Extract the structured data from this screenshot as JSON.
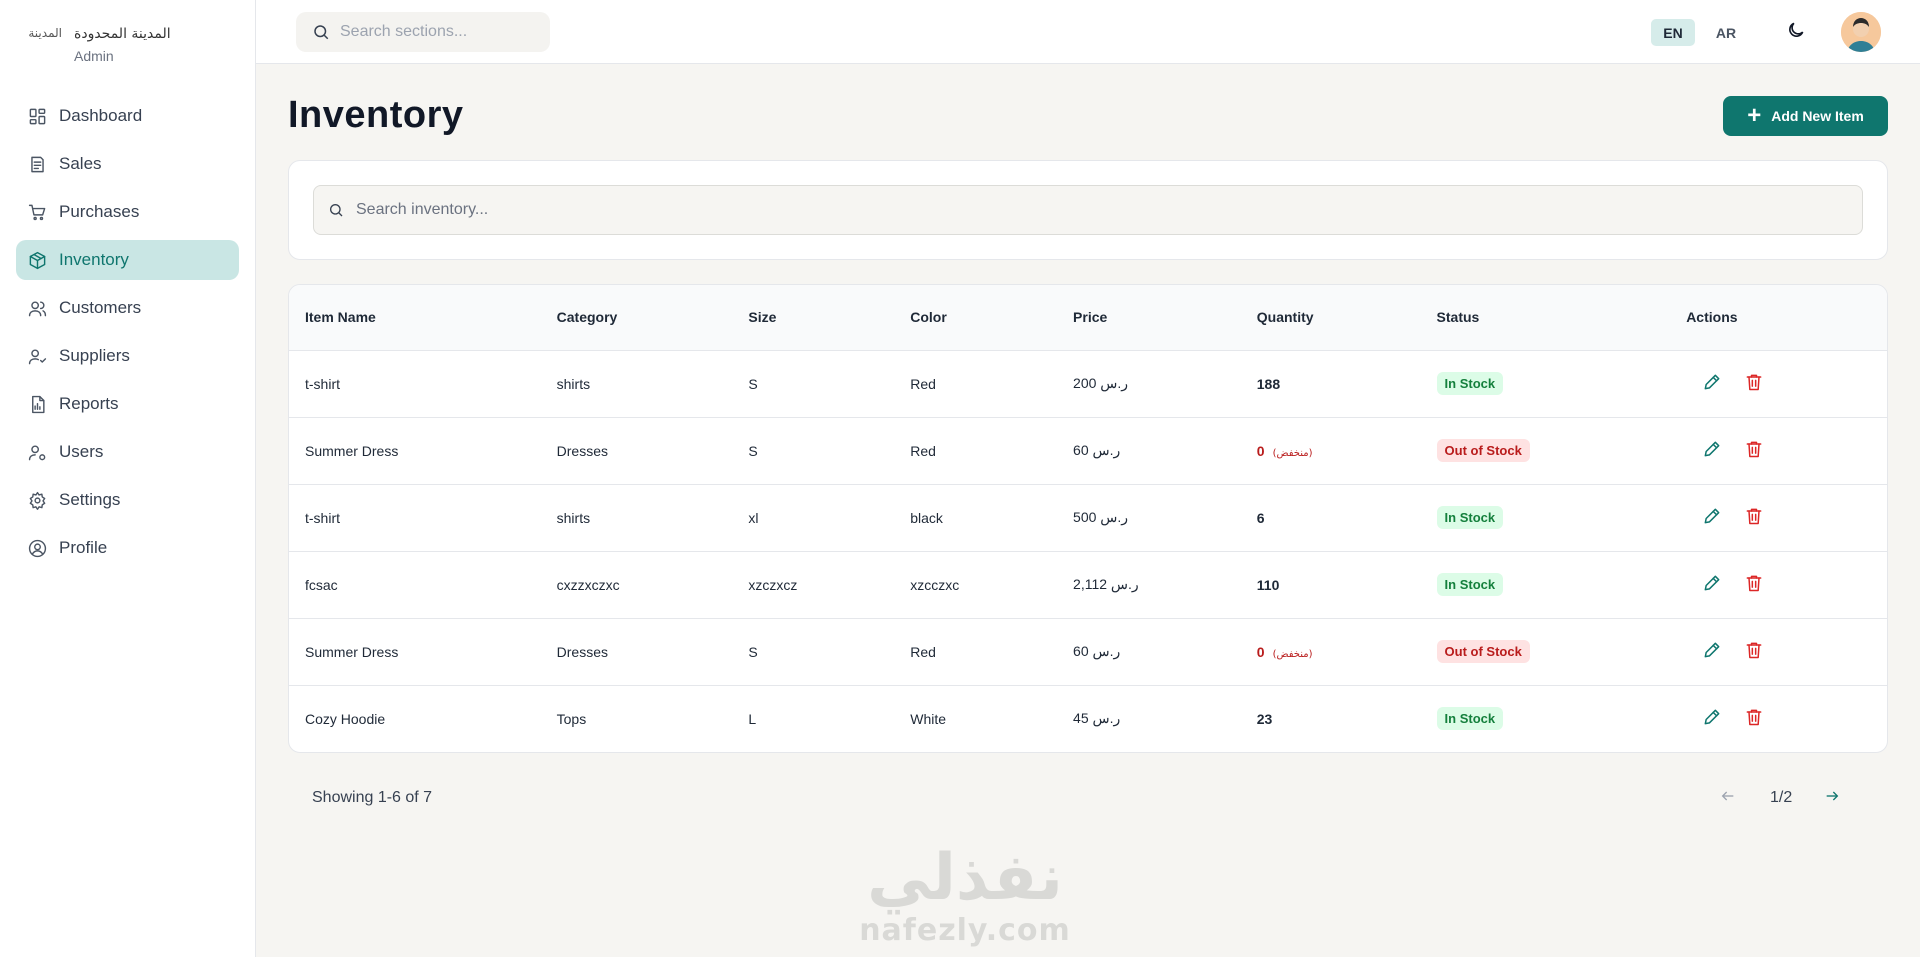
{
  "brand": {
    "logo_alt": "المدينة",
    "name": "المدينة المحدودة",
    "role": "Admin"
  },
  "sidebar": {
    "items": [
      {
        "label": "Dashboard",
        "icon": "dashboard-icon"
      },
      {
        "label": "Sales",
        "icon": "receipt-icon"
      },
      {
        "label": "Purchases",
        "icon": "cart-icon"
      },
      {
        "label": "Inventory",
        "icon": "box-icon",
        "active": true
      },
      {
        "label": "Customers",
        "icon": "users-icon"
      },
      {
        "label": "Suppliers",
        "icon": "supplier-icon"
      },
      {
        "label": "Reports",
        "icon": "report-icon"
      },
      {
        "label": "Users",
        "icon": "user-gear-icon"
      },
      {
        "label": "Settings",
        "icon": "gear-icon"
      },
      {
        "label": "Profile",
        "icon": "profile-icon"
      }
    ]
  },
  "topbar": {
    "search_placeholder": "Search sections...",
    "lang_en": "EN",
    "lang_ar": "AR"
  },
  "main": {
    "title": "Inventory",
    "add_button": "Add New Item",
    "search_placeholder": "Search inventory...",
    "columns": [
      "Item Name",
      "Category",
      "Size",
      "Color",
      "Price",
      "Quantity",
      "Status",
      "Actions"
    ],
    "rows": [
      {
        "name": "t-shirt",
        "category": "shirts",
        "size": "S",
        "color": "Red",
        "price": "ر.س 200",
        "quantity": "188",
        "low": "",
        "status": "In Stock"
      },
      {
        "name": "Summer Dress",
        "category": "Dresses",
        "size": "S",
        "color": "Red",
        "price": "ر.س 60",
        "quantity": "0",
        "low": "(منخفض)",
        "status": "Out of Stock"
      },
      {
        "name": "t-shirt",
        "category": "shirts",
        "size": "xl",
        "color": "black",
        "price": "ر.س 500",
        "quantity": "6",
        "low": "",
        "status": "In Stock"
      },
      {
        "name": "fcsac",
        "category": "cxzzxczxc",
        "size": "xzczxcz",
        "color": "xzcczxc",
        "price": "ر.س 2,112",
        "quantity": "110",
        "low": "",
        "status": "In Stock"
      },
      {
        "name": "Summer Dress",
        "category": "Dresses",
        "size": "S",
        "color": "Red",
        "price": "ر.س 60",
        "quantity": "0",
        "low": "(منخفض)",
        "status": "Out of Stock"
      },
      {
        "name": "Cozy Hoodie",
        "category": "Tops",
        "size": "L",
        "color": "White",
        "price": "ر.س 45",
        "quantity": "23",
        "low": "",
        "status": "In Stock"
      }
    ],
    "showing": "Showing 1-6 of 7",
    "page_label": "1/2"
  },
  "watermark": {
    "arabic": "نفذلي",
    "latin": "nafezly.com"
  },
  "colors": {
    "accent": "#0f766e",
    "active_bg": "#c9e6e4",
    "in_stock_bg": "#dcfce7",
    "out_stock_bg": "#fee2e2"
  }
}
